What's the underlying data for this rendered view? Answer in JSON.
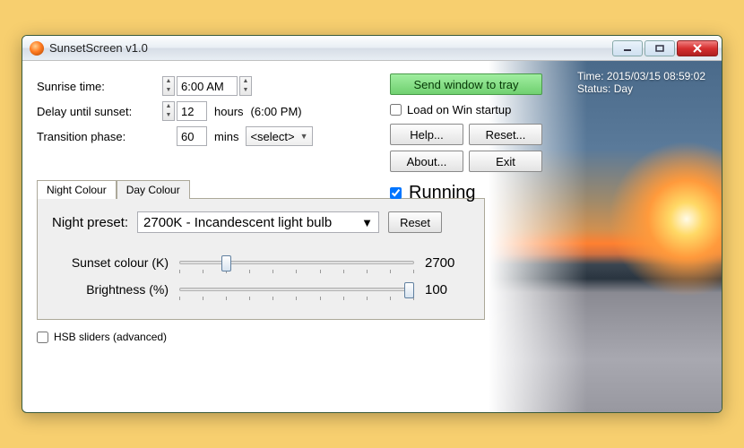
{
  "window": {
    "title": "SunsetScreen v1.0"
  },
  "labels": {
    "sunrise": "Sunrise time:",
    "delay": "Delay until sunset:",
    "hours": "hours",
    "delay_pm": "(6:00 PM)",
    "transition": "Transition phase:",
    "mins": "mins"
  },
  "values": {
    "sunrise_time": "6:00 AM",
    "delay_hours": "12",
    "transition_mins": "60",
    "transition_select": "<select>"
  },
  "right": {
    "tray": "Send window to tray",
    "load_startup": "Load on Win startup",
    "help": "Help...",
    "reset": "Reset...",
    "about": "About...",
    "exit": "Exit",
    "running": "Running"
  },
  "status": {
    "time_label": "Time: 2015/03/15 08:59:02",
    "status_label": "Status: Day"
  },
  "tabs": {
    "night": "Night Colour",
    "day": "Day Colour"
  },
  "panel": {
    "preset_label": "Night preset:",
    "preset_value": "2700K - Incandescent light bulb",
    "reset": "Reset",
    "colour_label": "Sunset colour (K)",
    "colour_value": "2700",
    "brightness_label": "Brightness (%)",
    "brightness_value": "100"
  },
  "hsb": "HSB sliders (advanced)",
  "colors": {
    "tray_btn": "#8be08b"
  }
}
